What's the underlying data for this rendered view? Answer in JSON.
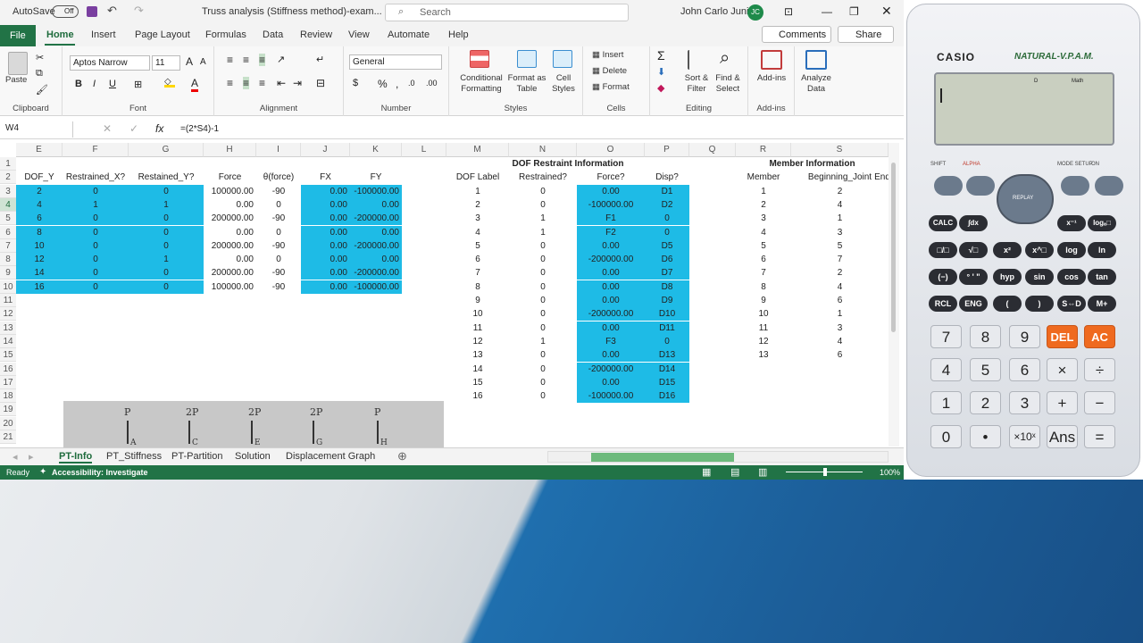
{
  "window": {
    "autosave": "AutoSave",
    "autosave_state": "Off",
    "title": "Truss analysis (Stiffness method)-exam...",
    "search": "Search",
    "user": "John Carlo Junio",
    "initials": "JC"
  },
  "tabs": [
    "File",
    "Home",
    "Insert",
    "Page Layout",
    "Formulas",
    "Data",
    "Review",
    "View",
    "Automate",
    "Help"
  ],
  "ribbon": {
    "comments": "Comments",
    "share": "Share",
    "font_name": "Aptos Narrow",
    "font_size": "11",
    "number_format": "General",
    "clipboard": "Clipboard",
    "paste": "Paste",
    "font": "Font",
    "alignment": "Alignment",
    "number": "Number",
    "styles": "Styles",
    "cells": "Cells",
    "editing": "Editing",
    "addins": "Add-ins",
    "cond1": "Conditional",
    "cond2": "Formatting",
    "fmt1": "Format as",
    "fmt2": "Table",
    "cs1": "Cell",
    "cs2": "Styles",
    "insert": "Insert",
    "delete": "Delete",
    "format": "Format",
    "sort1": "Sort &",
    "sort2": "Filter",
    "find1": "Find &",
    "find2": "Select",
    "addins_btn": "Add-ins",
    "an1": "Analyze",
    "an2": "Data"
  },
  "formula": {
    "cell": "W4",
    "text": "=(2*S4)-1"
  },
  "cols": [
    "E",
    "F",
    "G",
    "H",
    "I",
    "J",
    "K",
    "L",
    "M",
    "N",
    "O",
    "P",
    "Q",
    "R",
    "S"
  ],
  "left_headers": [
    "DOF_Y",
    "Restrained_X?",
    "Restained_Y?",
    "Force",
    "θ(force)",
    "FX",
    "FY"
  ],
  "left_rows": [
    [
      "2",
      "0",
      "0",
      "100000.00",
      "-90",
      "0.00",
      "-100000.00"
    ],
    [
      "4",
      "1",
      "1",
      "0.00",
      "0",
      "0.00",
      "0.00"
    ],
    [
      "6",
      "0",
      "0",
      "200000.00",
      "-90",
      "0.00",
      "-200000.00"
    ],
    [
      "8",
      "0",
      "0",
      "0.00",
      "0",
      "0.00",
      "0.00"
    ],
    [
      "10",
      "0",
      "0",
      "200000.00",
      "-90",
      "0.00",
      "-200000.00"
    ],
    [
      "12",
      "0",
      "1",
      "0.00",
      "0",
      "0.00",
      "0.00"
    ],
    [
      "14",
      "0",
      "0",
      "200000.00",
      "-90",
      "0.00",
      "-200000.00"
    ],
    [
      "16",
      "0",
      "0",
      "100000.00",
      "-90",
      "0.00",
      "-100000.00"
    ]
  ],
  "dof_title": "DOF Restraint Information",
  "dof_headers": [
    "DOF Label",
    "Restrained?",
    "Force?",
    "Disp?"
  ],
  "dof_rows": [
    [
      "1",
      "0",
      "0.00",
      "D1"
    ],
    [
      "2",
      "0",
      "-100000.00",
      "D2"
    ],
    [
      "3",
      "1",
      "F1",
      "0"
    ],
    [
      "4",
      "1",
      "F2",
      "0"
    ],
    [
      "5",
      "0",
      "0.00",
      "D5"
    ],
    [
      "6",
      "0",
      "-200000.00",
      "D6"
    ],
    [
      "7",
      "0",
      "0.00",
      "D7"
    ],
    [
      "8",
      "0",
      "0.00",
      "D8"
    ],
    [
      "9",
      "0",
      "0.00",
      "D9"
    ],
    [
      "10",
      "0",
      "-200000.00",
      "D10"
    ],
    [
      "11",
      "0",
      "0.00",
      "D11"
    ],
    [
      "12",
      "1",
      "F3",
      "0"
    ],
    [
      "13",
      "0",
      "0.00",
      "D13"
    ],
    [
      "14",
      "0",
      "-200000.00",
      "D14"
    ],
    [
      "15",
      "0",
      "0.00",
      "D15"
    ],
    [
      "16",
      "0",
      "-100000.00",
      "D16"
    ]
  ],
  "member_title": "Member Information",
  "member_headers": [
    "Member",
    "Beginning_Joint",
    "End"
  ],
  "member_rows": [
    [
      "1",
      "2"
    ],
    [
      "2",
      "4"
    ],
    [
      "3",
      "1"
    ],
    [
      "4",
      "3"
    ],
    [
      "5",
      "5"
    ],
    [
      "6",
      "7"
    ],
    [
      "7",
      "2"
    ],
    [
      "8",
      "4"
    ],
    [
      "9",
      "6"
    ],
    [
      "10",
      "1"
    ],
    [
      "11",
      "3"
    ],
    [
      "12",
      "4"
    ],
    [
      "13",
      "6"
    ]
  ],
  "image_labels": [
    "P",
    "2P",
    "2P",
    "2P",
    "P"
  ],
  "image_nodes": [
    "A",
    "C",
    "E",
    "G",
    "H"
  ],
  "sheets": [
    "PT-Info",
    "PT_Stiffness",
    "PT-Partition",
    "Solution",
    "Displacement Graph"
  ],
  "status": {
    "ready": "Ready",
    "accessibility": "Accessibility: Investigate",
    "zoom": "100%"
  },
  "calc": {
    "brand": "CASIO",
    "model": "NATURAL-V.P.A.M.",
    "display_mode": "Math",
    "display_d": "D",
    "fn_row1": [
      "SHIFT",
      "ALPHA",
      "REPLAY",
      "MODE SETUP",
      "ON"
    ],
    "keys_r1": [
      "CALC",
      "∫dx",
      "x⁻¹",
      "logₐ□"
    ],
    "keys_r2": [
      "□/□",
      "√□",
      "x²",
      "x^□",
      "log",
      "ln"
    ],
    "keys_r3": [
      "(−)",
      "° ' \"",
      "hyp",
      "sin",
      "cos",
      "tan"
    ],
    "keys_r4": [
      "RCL",
      "ENG",
      "(",
      ")",
      "S⇔D",
      "M+"
    ],
    "num_r1": [
      "7",
      "8",
      "9",
      "DEL",
      "AC"
    ],
    "num_r2": [
      "4",
      "5",
      "6",
      "×",
      "÷"
    ],
    "num_r3": [
      "1",
      "2",
      "3",
      "+",
      "−"
    ],
    "num_r4": [
      "0",
      "•",
      "×10ˣ",
      "Ans",
      "="
    ]
  }
}
